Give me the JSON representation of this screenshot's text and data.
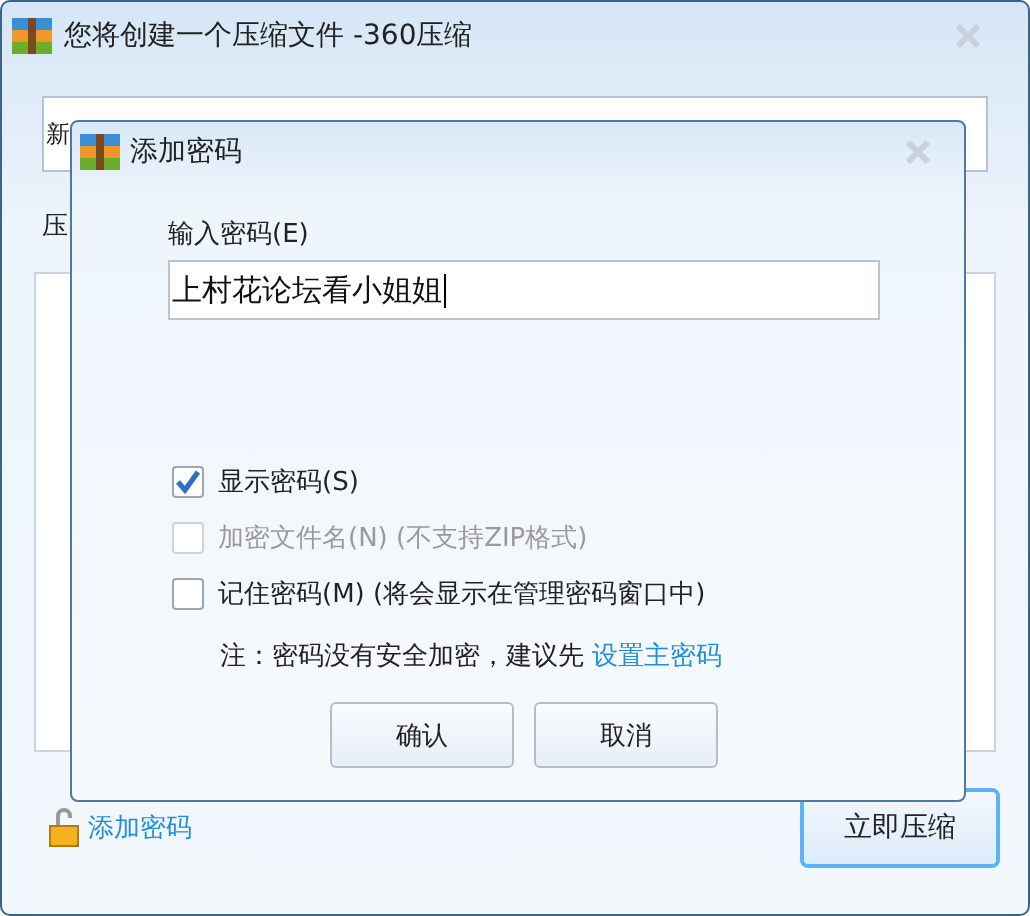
{
  "window": {
    "title": "您将创建一个压缩文件 -360压缩"
  },
  "path_field": {
    "value": "新"
  },
  "format_label": "压",
  "add_password_link": "添加密码",
  "compress_button": "立即压缩",
  "dialog": {
    "title": "添加密码",
    "password_label": "输入密码(E)",
    "password": "上村花论坛看小姐姐",
    "options": [
      {
        "label": "显示密码(S)",
        "checked": true,
        "disabled": false
      },
      {
        "label": "加密文件名(N) (不支持ZIP格式)",
        "checked": false,
        "disabled": true
      },
      {
        "label": "记住密码(M) (将会显示在管理密码窗口中)",
        "checked": false,
        "disabled": false
      }
    ],
    "note": "注：密码没有安全加密，建议先",
    "note_link": "设置主密码",
    "buttons": [
      "确认",
      "取消"
    ]
  }
}
